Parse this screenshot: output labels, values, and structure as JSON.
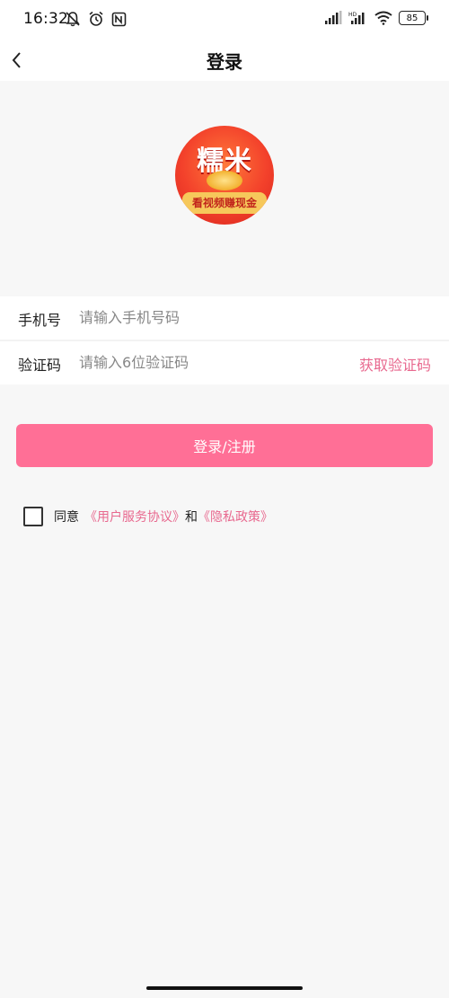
{
  "status_bar": {
    "time": "16:32",
    "battery": "85",
    "icons_left": [
      "bell-muted-icon",
      "alarm-icon",
      "nfc-icon"
    ],
    "icons_right": [
      "signal-icon",
      "hd-signal-icon",
      "wifi-icon",
      "battery-icon"
    ]
  },
  "nav": {
    "title": "登录",
    "back_icon": "chevron-left-icon"
  },
  "logo": {
    "title": "糯米",
    "slogan": "看视频赚现金"
  },
  "form": {
    "phone_label": "手机号",
    "phone_placeholder": "请输入手机号码",
    "phone_value": "",
    "code_label": "验证码",
    "code_placeholder": "请输入6位验证码",
    "code_value": "",
    "get_code": "获取验证码"
  },
  "login_button": "登录/注册",
  "agreement": {
    "checked": false,
    "prefix": "同意",
    "terms": "《用户服务协议》",
    "and": "和",
    "privacy": "《隐私政策》"
  },
  "colors": {
    "accent": "#ff6f96",
    "link": "#e8698f",
    "background": "#f7f7f7"
  }
}
